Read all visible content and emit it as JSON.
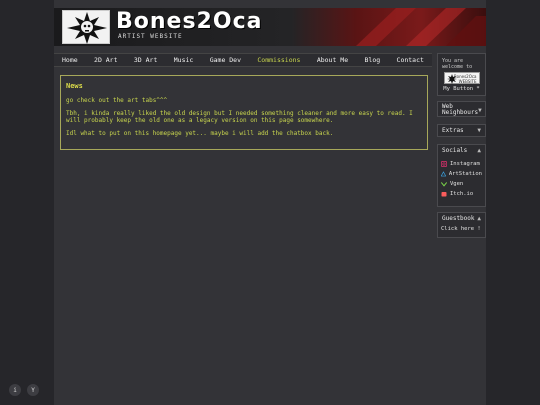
{
  "banner": {
    "title": "Bones2Oca",
    "subtitle": "ARTIST WEBSITE"
  },
  "nav": {
    "items": [
      {
        "label": "Home"
      },
      {
        "label": "2D Art"
      },
      {
        "label": "3D Art"
      },
      {
        "label": "Music"
      },
      {
        "label": "Game Dev"
      },
      {
        "label": "Commissions"
      },
      {
        "label": "About Me"
      },
      {
        "label": "Blog"
      },
      {
        "label": "Contact"
      }
    ],
    "active": "Commissions"
  },
  "news": {
    "title": "News",
    "paragraphs": [
      "go check out the art tabs^^^",
      "Tbh, i kinda really liked the old design but I needed something cleaner and more easy to read. I will probably keep the old one as a legacy version on this page somewhere.",
      "Idl what to put on this homepage yet... maybe i will add the chatbox back."
    ]
  },
  "sidebar": {
    "button_box": {
      "text": "You are welcome to",
      "badge_text": "Bones2Oca WEBSITE",
      "my_button": "My Button *"
    },
    "web_neighbours": {
      "label": "Web Neighbours",
      "arrow": "▼"
    },
    "extras": {
      "label": "Extras",
      "arrow": "▼"
    },
    "socials": {
      "label": "Socials",
      "arrow": "▲",
      "items": [
        {
          "label": "Instagram",
          "icon": "instagram-icon",
          "color": "#d9306b"
        },
        {
          "label": "ArtStation",
          "icon": "artstation-icon",
          "color": "#3aa2e0"
        },
        {
          "label": "Vgen",
          "icon": "vgen-icon",
          "color": "#7bd44a"
        },
        {
          "label": "Itch.io",
          "icon": "itchio-icon",
          "color": "#fa5c5c"
        }
      ]
    },
    "guestbook": {
      "label": "Guestbook",
      "arrow": "▲",
      "link": "Click here !"
    }
  },
  "corner": {
    "info": "i",
    "filter": "Y"
  },
  "colors": {
    "accent": "#c9d64e",
    "news_border": "#a7a85a",
    "background": "#26262a",
    "panel": "#333337"
  }
}
